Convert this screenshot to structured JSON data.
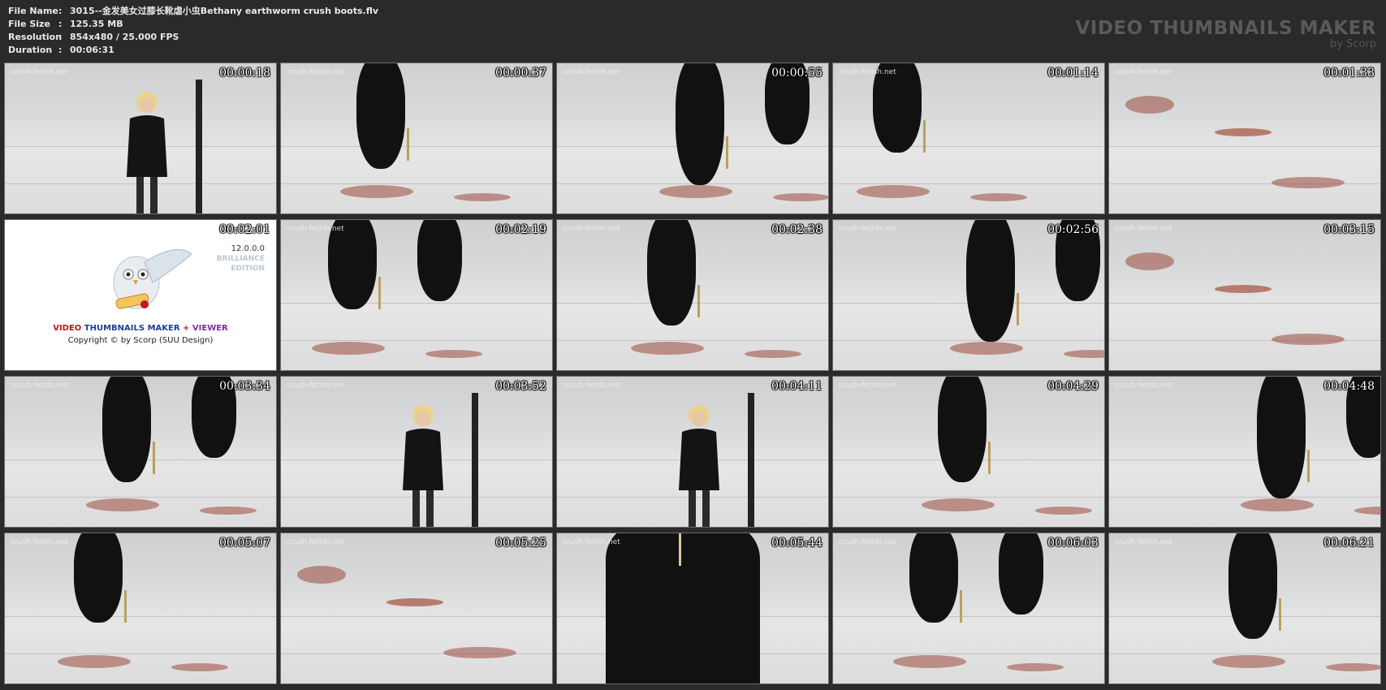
{
  "header": {
    "file_name_label": "File Name",
    "file_name_value": "3015--金发美女过膝长靴虐小虫Bethany earthworm crush boots.flv",
    "file_size_label": "File Size",
    "file_size_value": "125.35 MB",
    "resolution_label": "Resolution",
    "resolution_value": "854x480 / 25.000 FPS",
    "duration_label": "Duration",
    "duration_value": "00:06:31",
    "separator": ":"
  },
  "brand": {
    "title": "VIDEO THUMBNAILS MAKER",
    "byline": "by Scorp"
  },
  "watermark": "crush-fetish.net",
  "logo": {
    "version": "12.0.0.0",
    "edition_1": "BRILLIANCE",
    "edition_2": "EDITION",
    "name_part1": "VIDEO",
    "name_part2": "THUMBNAILS MAKER",
    "name_part3": "+",
    "name_part4": "VIEWER",
    "copyright": "Copyright © by Scorp (SUU Design)",
    "color_red": "#c0171c",
    "color_blue": "#1d3f8f",
    "color_purple": "#7b2fa0"
  },
  "thumbnails": [
    {
      "time": "00:00:18",
      "scene": "person"
    },
    {
      "time": "00:00:37",
      "scene": "boots"
    },
    {
      "time": "00:00:55",
      "scene": "boots"
    },
    {
      "time": "00:01:14",
      "scene": "boots"
    },
    {
      "time": "00:01:33",
      "scene": "floor"
    },
    {
      "time": "00:02:01",
      "scene": "logo"
    },
    {
      "time": "00:02:19",
      "scene": "boots"
    },
    {
      "time": "00:02:38",
      "scene": "boots"
    },
    {
      "time": "00:02:56",
      "scene": "boots"
    },
    {
      "time": "00:03:15",
      "scene": "floor"
    },
    {
      "time": "00:03:34",
      "scene": "boots"
    },
    {
      "time": "00:03:52",
      "scene": "person"
    },
    {
      "time": "00:04:11",
      "scene": "person"
    },
    {
      "time": "00:04:29",
      "scene": "boots"
    },
    {
      "time": "00:04:48",
      "scene": "boots"
    },
    {
      "time": "00:05:07",
      "scene": "boots"
    },
    {
      "time": "00:05:25",
      "scene": "floor"
    },
    {
      "time": "00:05:44",
      "scene": "dress"
    },
    {
      "time": "00:06:03",
      "scene": "boots"
    },
    {
      "time": "00:06:21",
      "scene": "boots"
    }
  ]
}
